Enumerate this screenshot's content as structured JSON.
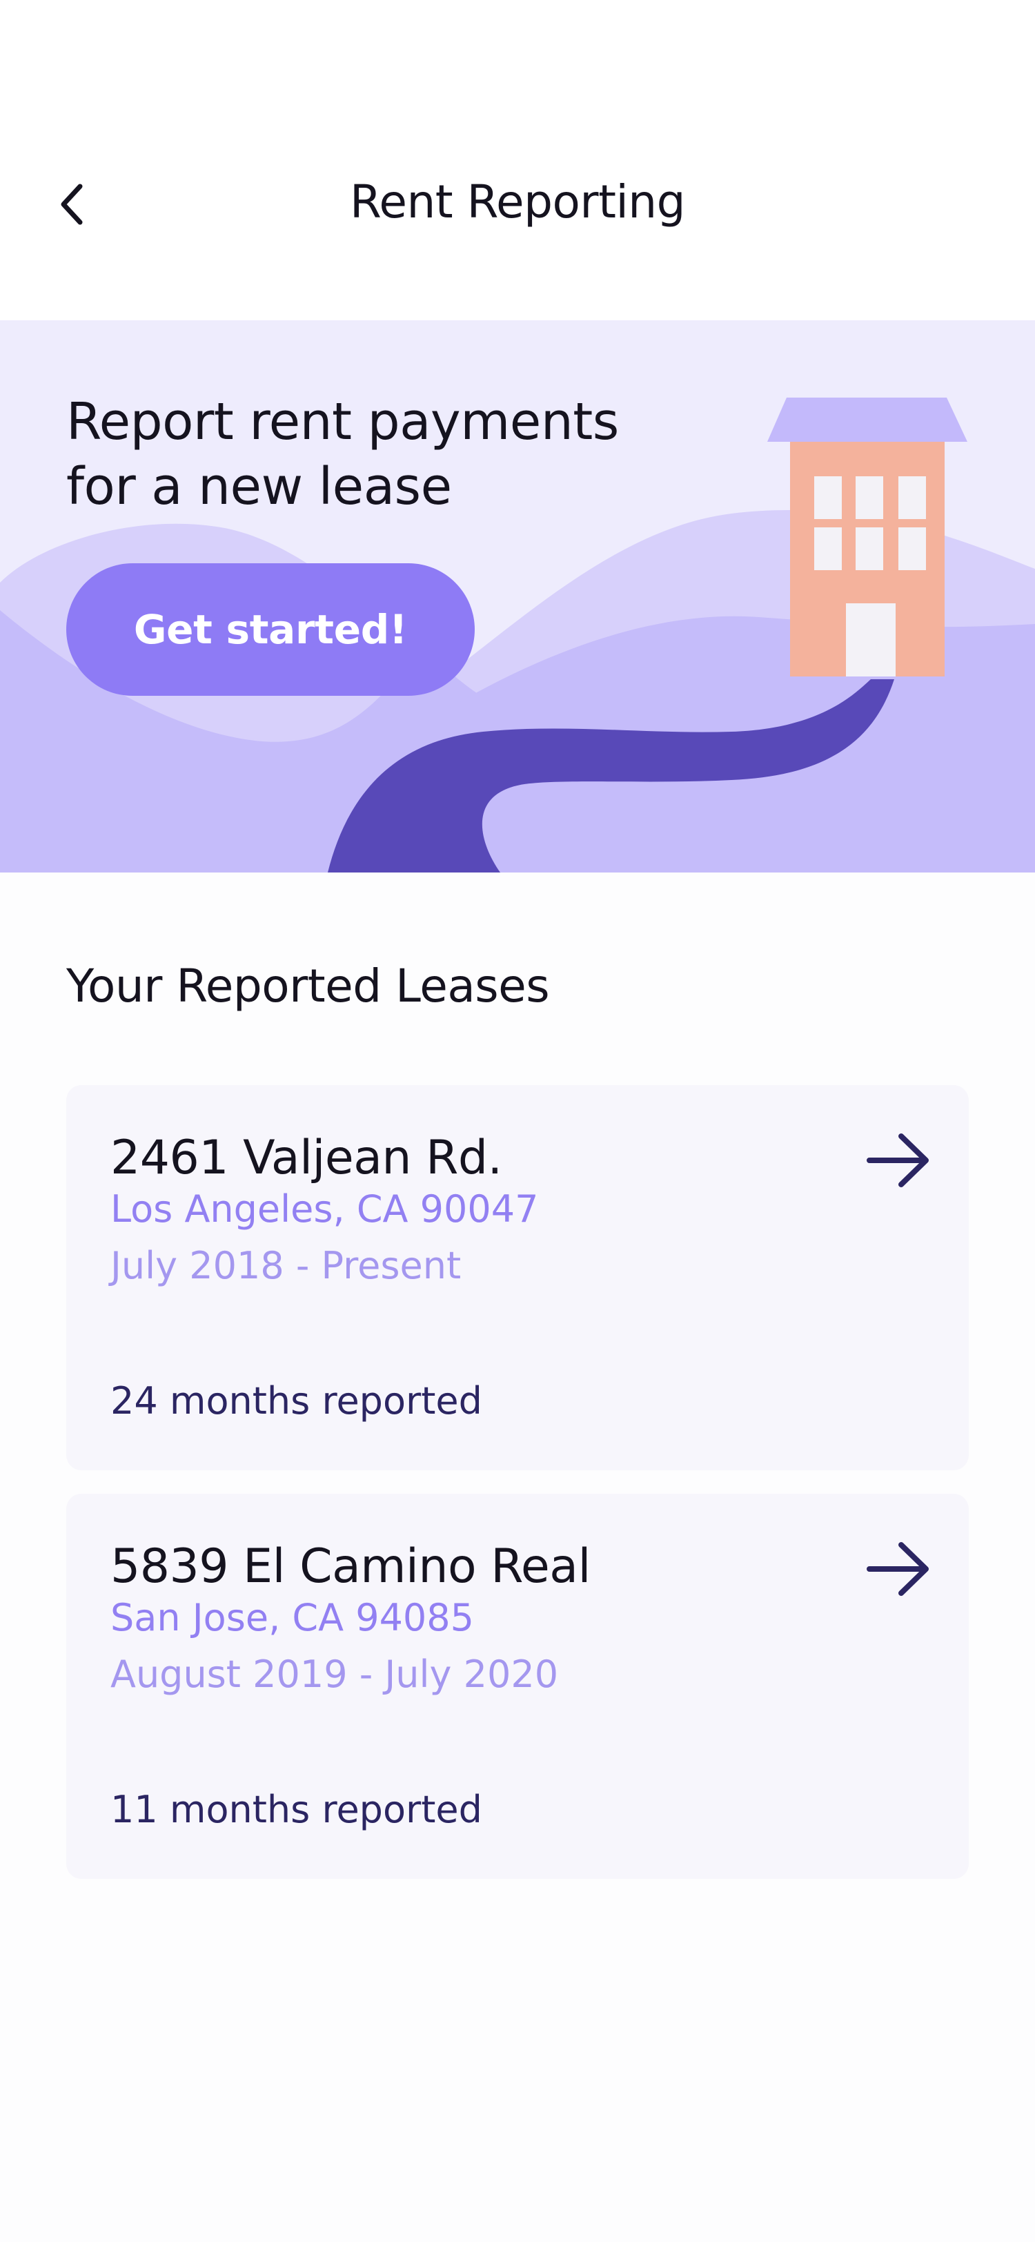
{
  "header": {
    "title": "Rent Reporting",
    "back_icon": "chevron-left-icon"
  },
  "banner": {
    "title_line1": "Report rent payments",
    "title_line2": "for a new lease",
    "button_label": "Get started!",
    "illustration": "building-on-hill-illustration",
    "colors": {
      "background": "#eeecfd",
      "hill_light": "#d7d0fb",
      "hill_mid": "#c5bcfa",
      "road": "#5849b8",
      "building": "#f4b29c",
      "roof": "#c3b9fb",
      "button": "#8e7bf5"
    }
  },
  "leases": {
    "section_title": "Your Reported Leases",
    "items": [
      {
        "address": "2461 Valjean Rd.",
        "city": "Los Angeles, CA 90047",
        "dates": "July 2018 - Present",
        "months": "24 months reported",
        "icon": "arrow-right-icon"
      },
      {
        "address": "5839 El Camino Real",
        "city": "San Jose, CA 94085",
        "dates": "August 2019 - July 2020",
        "months": "11 months reported",
        "icon": "arrow-right-icon"
      }
    ]
  },
  "colors": {
    "text_primary": "#15131f",
    "accent": "#9280f2",
    "muted_accent": "#a497ef",
    "dark_navy": "#2b2562",
    "card_bg": "#f7f6fc"
  }
}
